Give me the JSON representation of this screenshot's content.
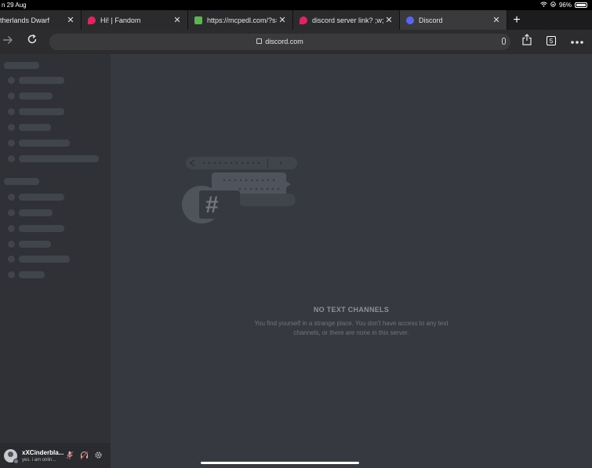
{
  "status_bar": {
    "time": "n 29 Aug",
    "battery": "96%"
  },
  "tabs": [
    {
      "title": "therlands Dwarf",
      "favicon_color": "",
      "active": false
    },
    {
      "title": "Hi! | Fandom",
      "favicon_color": "#e0245e",
      "active": false
    },
    {
      "title": "https://mcpedl.com/?s=t",
      "favicon_color": "#5bb450",
      "active": false
    },
    {
      "title": "discord server link? ;w; |",
      "favicon_color": "#e0245e",
      "active": false
    },
    {
      "title": "Discord",
      "favicon_color": "#5865f2",
      "active": true
    }
  ],
  "browser": {
    "url": "discord.com",
    "tab_count": "5"
  },
  "icons": {
    "back": "back-arrow-icon",
    "forward": "forward-arrow-icon",
    "reload": "reload-icon",
    "share": "share-icon",
    "more": "more-icon",
    "lock": "lock-icon",
    "mic": "mic-icon",
    "new_tab": "plus-icon",
    "close": "close-icon"
  },
  "user": {
    "name": "xXCinderbla...",
    "status": "yes. i am onlin..."
  },
  "empty_state": {
    "title": "NO TEXT CHANNELS",
    "message": "You find yourself in a strange place. You don't have access to any text channels, or there are none in this server."
  },
  "colors": {
    "sidebar": "#2f3136",
    "main": "#36393f",
    "user_panel": "#292b2f",
    "skeleton": "#40444b"
  }
}
